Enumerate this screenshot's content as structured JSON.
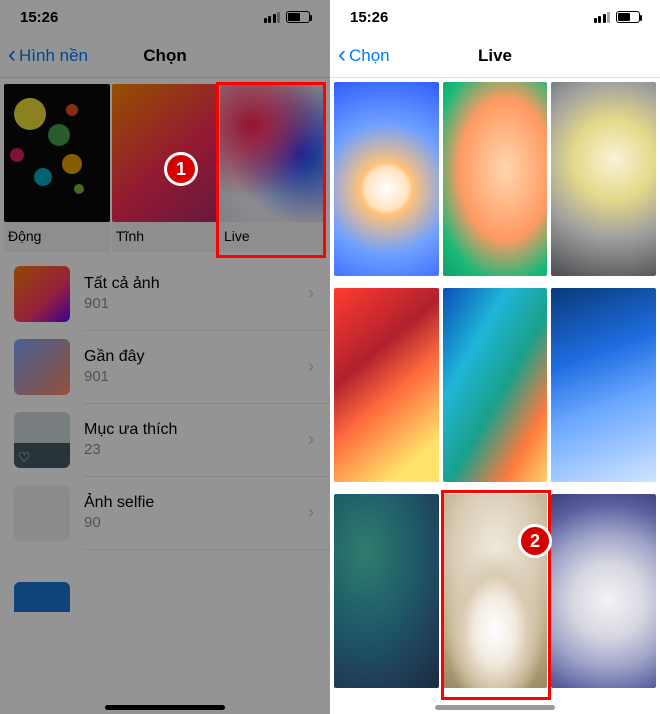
{
  "status": {
    "time": "15:26"
  },
  "screen1": {
    "back_label": "Hình nền",
    "title": "Chọn",
    "categories": [
      {
        "label": "Động"
      },
      {
        "label": "Tĩnh"
      },
      {
        "label": "Live"
      }
    ],
    "albums": [
      {
        "title": "Tất cả ảnh",
        "count": "901"
      },
      {
        "title": "Gần đây",
        "count": "901"
      },
      {
        "title": "Mục ưa thích",
        "count": "23"
      },
      {
        "title": "Ảnh selfie",
        "count": "90"
      }
    ],
    "badge": "1"
  },
  "screen2": {
    "back_label": "Chọn",
    "title": "Live",
    "badge": "2"
  }
}
